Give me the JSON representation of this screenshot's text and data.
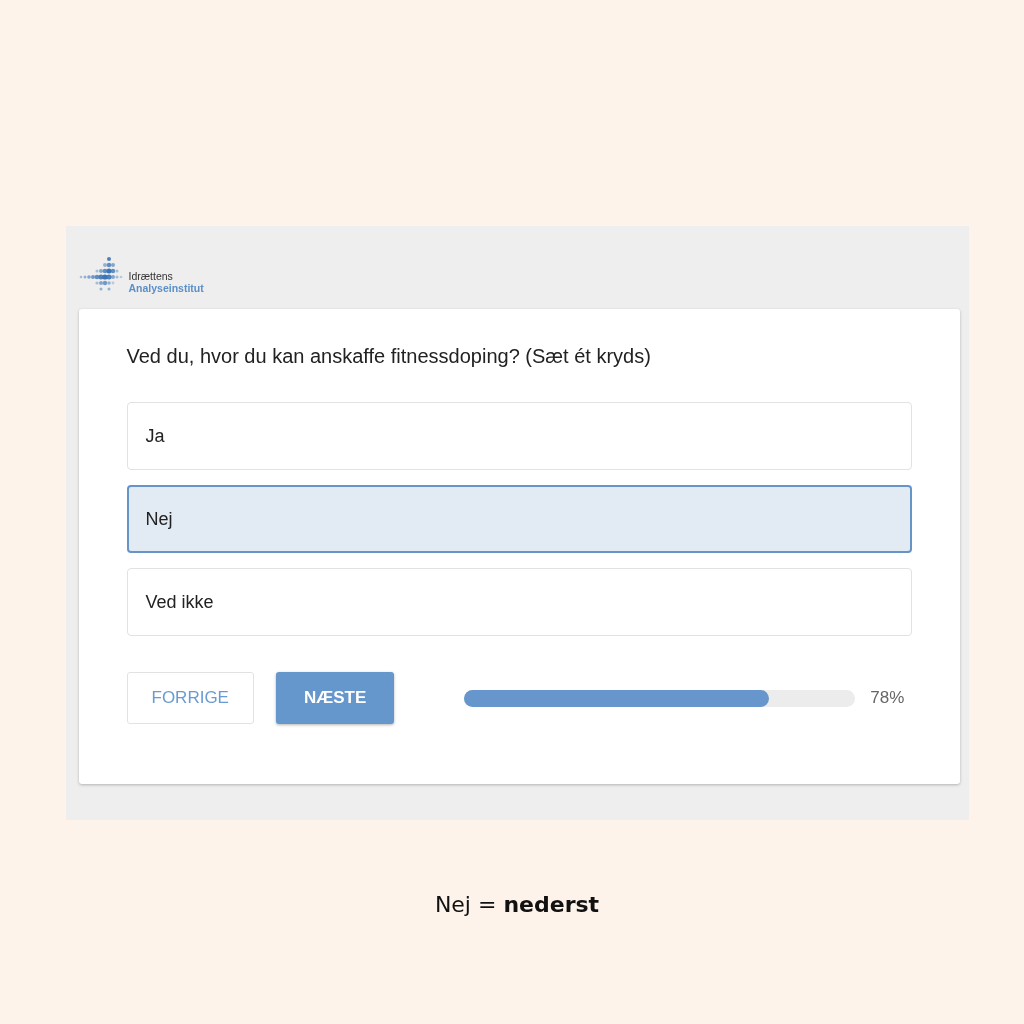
{
  "logo": {
    "line_1": "Idrættens",
    "line_2": "Analyseinstitut"
  },
  "question": "Ved du, hvor du kan anskaffe fitnessdoping? (Sæt ét kryds)",
  "options": [
    {
      "label": "Ja",
      "selected": false
    },
    {
      "label": "Nej",
      "selected": true
    },
    {
      "label": "Ved ikke",
      "selected": false
    }
  ],
  "buttons": [
    {
      "label": "FORRIGE",
      "kind": "secondary"
    },
    {
      "label": "NÆSTE",
      "kind": "primary"
    }
  ],
  "progress": {
    "level": 0.78,
    "reading": "78%"
  },
  "caption": "Nej = **nederst**"
}
